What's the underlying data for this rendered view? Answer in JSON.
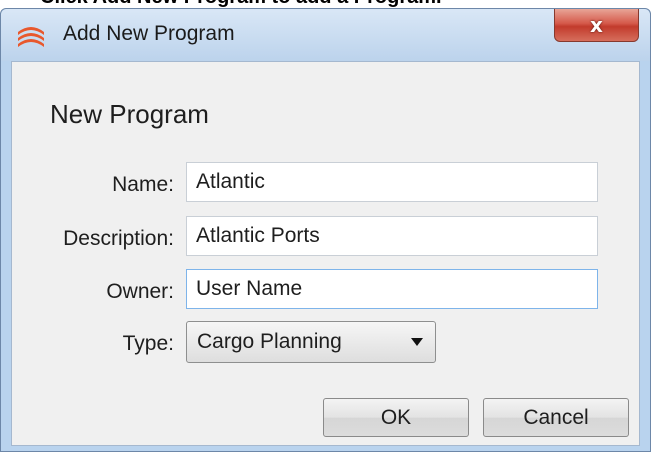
{
  "doc_crop_text": "Click Add New Program to add a Program.",
  "dialog": {
    "title": "Add New Program",
    "close_glyph": "x",
    "heading": "New Program",
    "fields": {
      "name": {
        "label": "Name:",
        "value": "Atlantic"
      },
      "description": {
        "label": "Description:",
        "value": "Atlantic Ports"
      },
      "owner": {
        "label": "Owner:",
        "value": "User Name"
      },
      "type": {
        "label": "Type:",
        "value": "Cargo Planning"
      }
    },
    "buttons": {
      "ok": "OK",
      "cancel": "Cancel"
    },
    "icons": {
      "app": "app-logo-icon",
      "dropdown": "chevron-down-icon",
      "close": "close-icon"
    },
    "colors": {
      "close_button": "#c9473a",
      "logo": "#e8582d",
      "focus_border": "#7eb4ea"
    }
  }
}
